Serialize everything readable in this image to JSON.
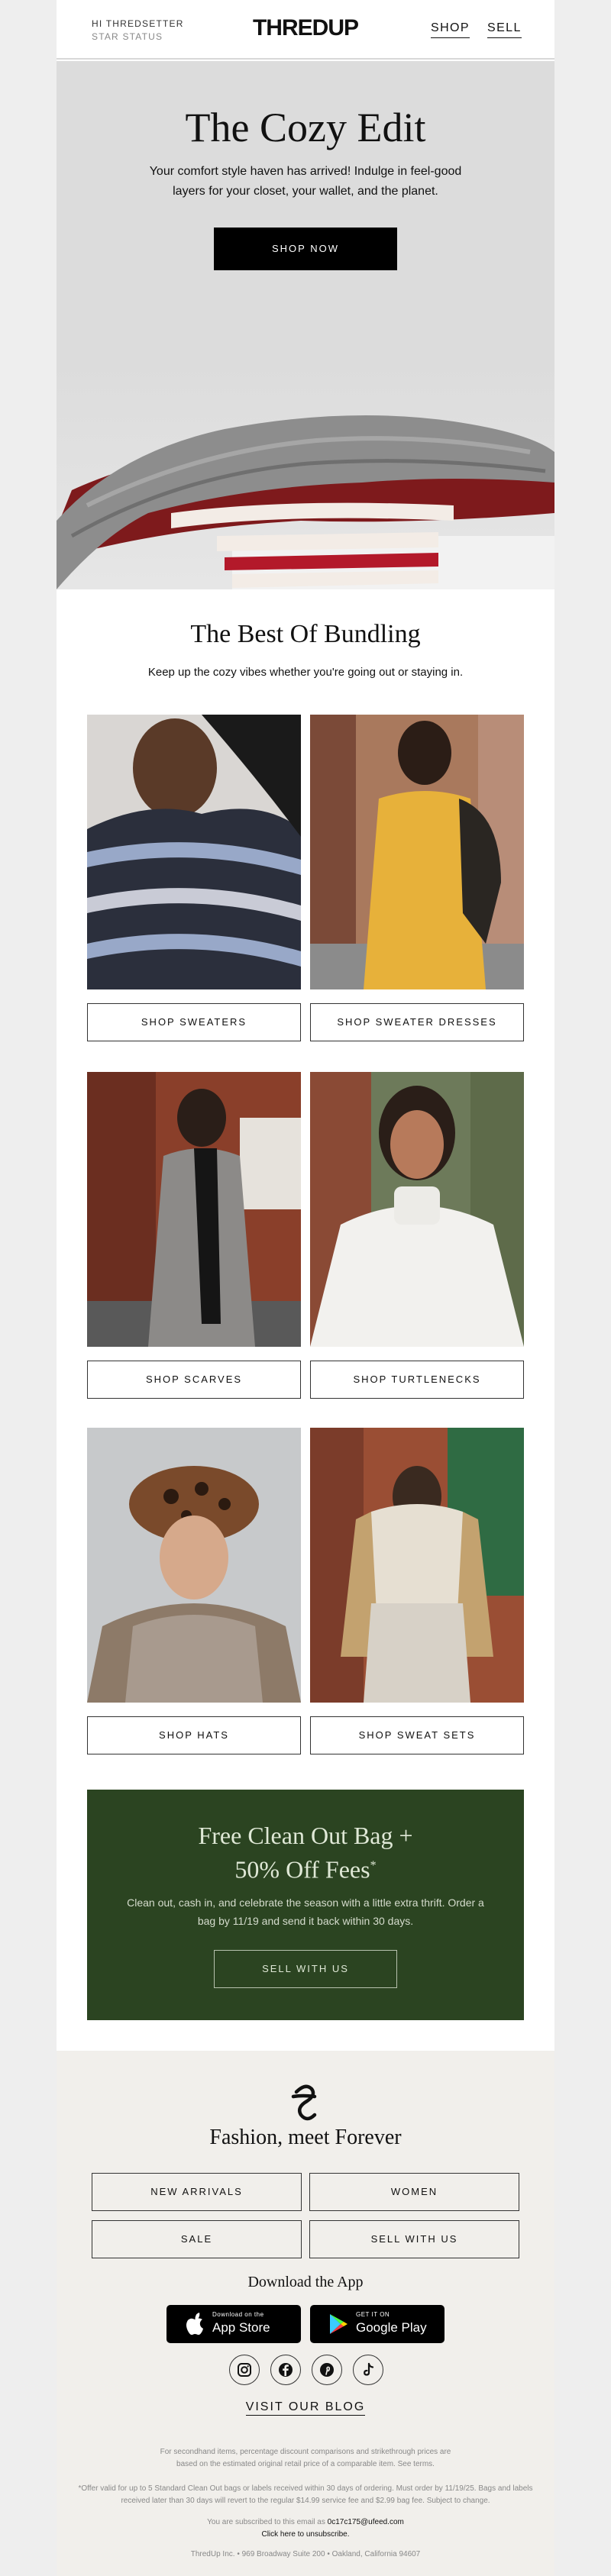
{
  "header": {
    "greeting": "HI THREDSETTER",
    "status": "STAR STATUS",
    "logo": "THREDUP",
    "nav": [
      "SHOP",
      "SELL"
    ]
  },
  "hero": {
    "title": "The Cozy Edit",
    "body": "Your comfort style haven has arrived! Indulge in feel-good layers for your closet, your wallet, and the planet.",
    "cta": "SHOP NOW"
  },
  "bundling": {
    "title": "The Best Of Bundling",
    "body": "Keep up the cozy vibes whether you're going out or staying in.",
    "items": [
      {
        "label": "SHOP SWEATERS"
      },
      {
        "label": "SHOP SWEATER DRESSES"
      },
      {
        "label": "SHOP SCARVES"
      },
      {
        "label": "SHOP TURTLENECKS"
      },
      {
        "label": "SHOP HATS"
      },
      {
        "label": "SHOP SWEAT SETS"
      }
    ]
  },
  "promo": {
    "title_line1": "Free Clean Out Bag +",
    "title_line2": "50% Off Fees",
    "title_mark": "*",
    "body": "Clean out, cash in, and celebrate the season with a little extra thrift. Order a bag by 11/19 and send it back within 30 days.",
    "cta": "SELL WITH US"
  },
  "footer": {
    "tagline": "Fashion, meet Forever",
    "links": [
      "NEW ARRIVALS",
      "WOMEN",
      "SALE",
      "SELL WITH US"
    ],
    "app_heading": "Download the App",
    "app_store_small": "Download on the",
    "app_store_big": "App Store",
    "google_small": "GET IT ON",
    "google_big": "Google Play",
    "social": [
      "instagram-icon",
      "facebook-icon",
      "pinterest-icon",
      "tiktok-icon"
    ],
    "blog": "VISIT OUR BLOG",
    "disclaimer1": "For secondhand items, percentage discount comparisons and strikethrough prices are based on the estimated original retail price of a comparable item. See terms.",
    "disclaimer2": "*Offer valid for up to 5 Standard Clean Out bags or labels received within 30 days of ordering. Must order by 11/19/25. Bags and labels received later than 30 days will revert to the regular $14.99 service fee and $2.99 bag fee. Subject to change.",
    "subscribed_prefix": "You are subscribed to this email as",
    "email": "0c17c175@ufeed.com",
    "unsubscribe": "Click here to unsubscribe.",
    "address": "ThredUp Inc. • 969 Broadway Suite 200 • Oakland, California 94607"
  },
  "colors": {
    "promo_bg": "#2b4421",
    "footer_bg": "#f1efeb",
    "hero_bg": "#dcdcdc"
  }
}
